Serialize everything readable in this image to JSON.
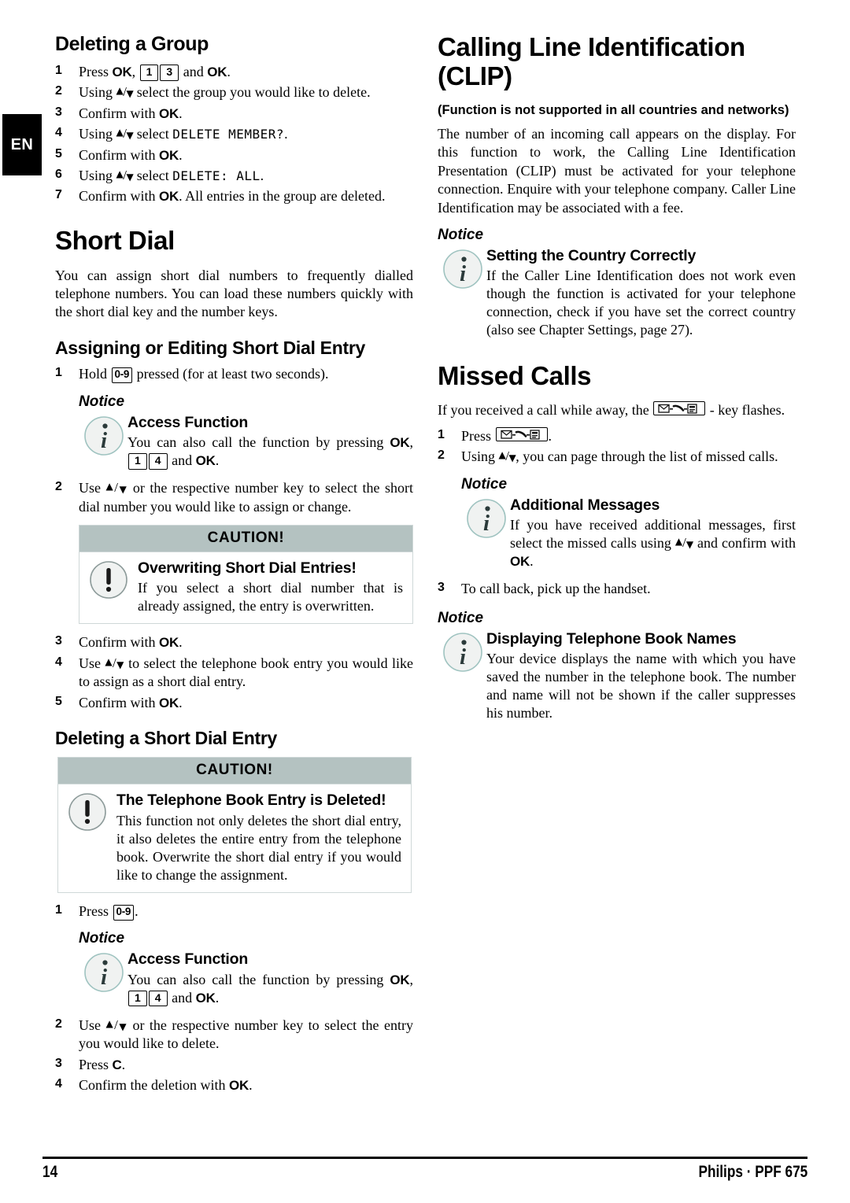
{
  "page": {
    "language_tab": "EN",
    "number": "14",
    "brand": "Philips · PPF 675"
  },
  "colors": {
    "caution_header": "#b4c2c1",
    "caution_border": "#cfd8d8",
    "tab_background": "#000000"
  },
  "labels": {
    "notice": "Notice",
    "caution": "CAUTION!",
    "ok_key": "OK",
    "c_key": "C",
    "key_1": "1",
    "key_3": "3",
    "key_4": "4",
    "key_0_9": "0-9",
    "updown": "▲/▼"
  },
  "left_column": {
    "deleting_group": {
      "heading": "Deleting a Group",
      "steps": [
        {
          "n": "1",
          "parts": [
            "Press ",
            "OK",
            ", ",
            "[1]",
            "[3]",
            " and ",
            "OK",
            "."
          ]
        },
        {
          "n": "2",
          "text_a": "Using ",
          "text_b": " select the group you would like to delete."
        },
        {
          "n": "3",
          "text_a": "Confirm with ",
          "text_b": "."
        },
        {
          "n": "4",
          "text_a": "Using ",
          "text_b": " select ",
          "lcd": "DELETE MEMBER?",
          "text_c": "."
        },
        {
          "n": "5",
          "text_a": "Confirm with ",
          "text_b": "."
        },
        {
          "n": "6",
          "text_a": "Using ",
          "text_b": " select ",
          "lcd": "DELETE: ALL",
          "text_c": "."
        },
        {
          "n": "7",
          "text_a": "Confirm with ",
          "text_b": ". All entries in the group are deleted."
        }
      ]
    },
    "short_dial": {
      "heading": "Short Dial",
      "intro": "You can assign short dial numbers to frequently dialled telephone numbers. You can load these numbers quickly with the short dial key and the number keys."
    },
    "assigning": {
      "heading": "Assigning or Editing Short Dial Entry",
      "step1_a": "Hold ",
      "step1_b": " pressed (for at least two seconds).",
      "notice": {
        "title": "Access Function",
        "text_a": "You can also call the function by pressing ",
        "text_b": ", ",
        "text_c": " and ",
        "text_d": "."
      },
      "step2": "Use ▲/▼ or the respective number key to select the short dial number you would like to assign or change.",
      "step2_a": "Use ",
      "step2_b": " or the respective number key to select the short dial number you would like to assign or change.",
      "caution": {
        "header": "CAUTION!",
        "title": "Overwriting Short Dial Entries!",
        "text": "If you select a short dial number that is already assigned, the entry is overwritten."
      },
      "step3_a": "Confirm with ",
      "step3_b": ".",
      "step4_a": "Use ",
      "step4_b": " to select the telephone book entry you would like to assign as a short dial entry.",
      "step5_a": "Confirm with ",
      "step5_b": "."
    },
    "deleting_entry": {
      "heading": "Deleting a Short Dial Entry",
      "caution": {
        "header": "CAUTION!",
        "title": "The Telephone Book Entry is Deleted!",
        "text": "This function not only deletes the short dial entry, it also deletes the entire entry from the telephone book. Overwrite the short dial entry if you would like to change the assignment."
      },
      "step1_a": "Press ",
      "step1_b": ".",
      "notice": {
        "title": "Access Function",
        "text_a": "You can also call the function by pressing ",
        "text_b": ", ",
        "text_c": " and ",
        "text_d": "."
      },
      "step2_a": "Use ",
      "step2_b": " or the respective number key to select the entry you would like to delete.",
      "step3_a": "Press ",
      "step3_b": ".",
      "step4_a": "Confirm the deletion with ",
      "step4_b": "."
    }
  },
  "right_column": {
    "clip": {
      "heading": "Calling Line Identification (CLIP)",
      "subnote": "(Function is not supported in all countries and networks)",
      "body": "The number of an incoming call appears on the display. For this function to work, the Calling Line Identification Presentation (CLIP) must be activated for your telephone connection. Enquire with your telephone company. Caller Line Identification may be associated with a fee.",
      "notice": {
        "title": "Setting the Country Correctly",
        "text": "If the Caller Line Identification does not work even though the function is activated for your telephone connection, check if you have set the correct country (also see Chapter Settings, page 27)."
      }
    },
    "missed_calls": {
      "heading": "Missed Calls",
      "intro_a": "If you received a call while away, the ",
      "intro_b": " - key flashes.",
      "step1_a": "Press ",
      "step1_b": ".",
      "step2_a": "Using ",
      "step2_b": ", you can page through the list of missed calls.",
      "notice_1": {
        "title": "Additional Messages",
        "text_a": "If you have received additional messages, first select the missed calls using ",
        "text_b": " and confirm with ",
        "text_c": "."
      },
      "step3": "To call back, pick up the handset.",
      "notice_2": {
        "title": "Displaying Telephone Book Names",
        "text": "Your device displays the name with which you have saved the number in the telephone book. The number and name will not be shown if the caller suppresses his number."
      }
    }
  }
}
